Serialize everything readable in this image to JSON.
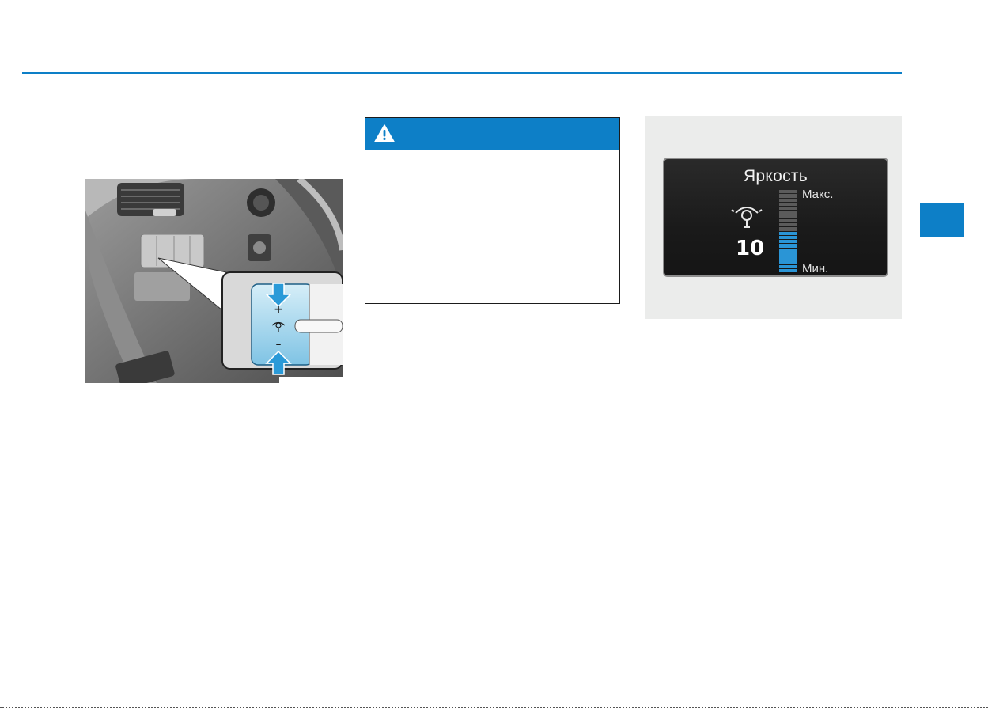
{
  "accent_color": "#0d7fc7",
  "warning": {
    "icon": "warning-triangle-icon"
  },
  "illustration": {
    "plus_label": "+",
    "minus_label": "–",
    "icons": [
      "arrow-down-icon",
      "arrow-up-icon",
      "dimmer-icon"
    ]
  },
  "brightness_display": {
    "title": "Яркость",
    "value": "10",
    "max_label": "Макс.",
    "min_label": "Мин.",
    "level_fraction": 0.5,
    "segments_total": 20,
    "icon": "bulb-icon"
  }
}
